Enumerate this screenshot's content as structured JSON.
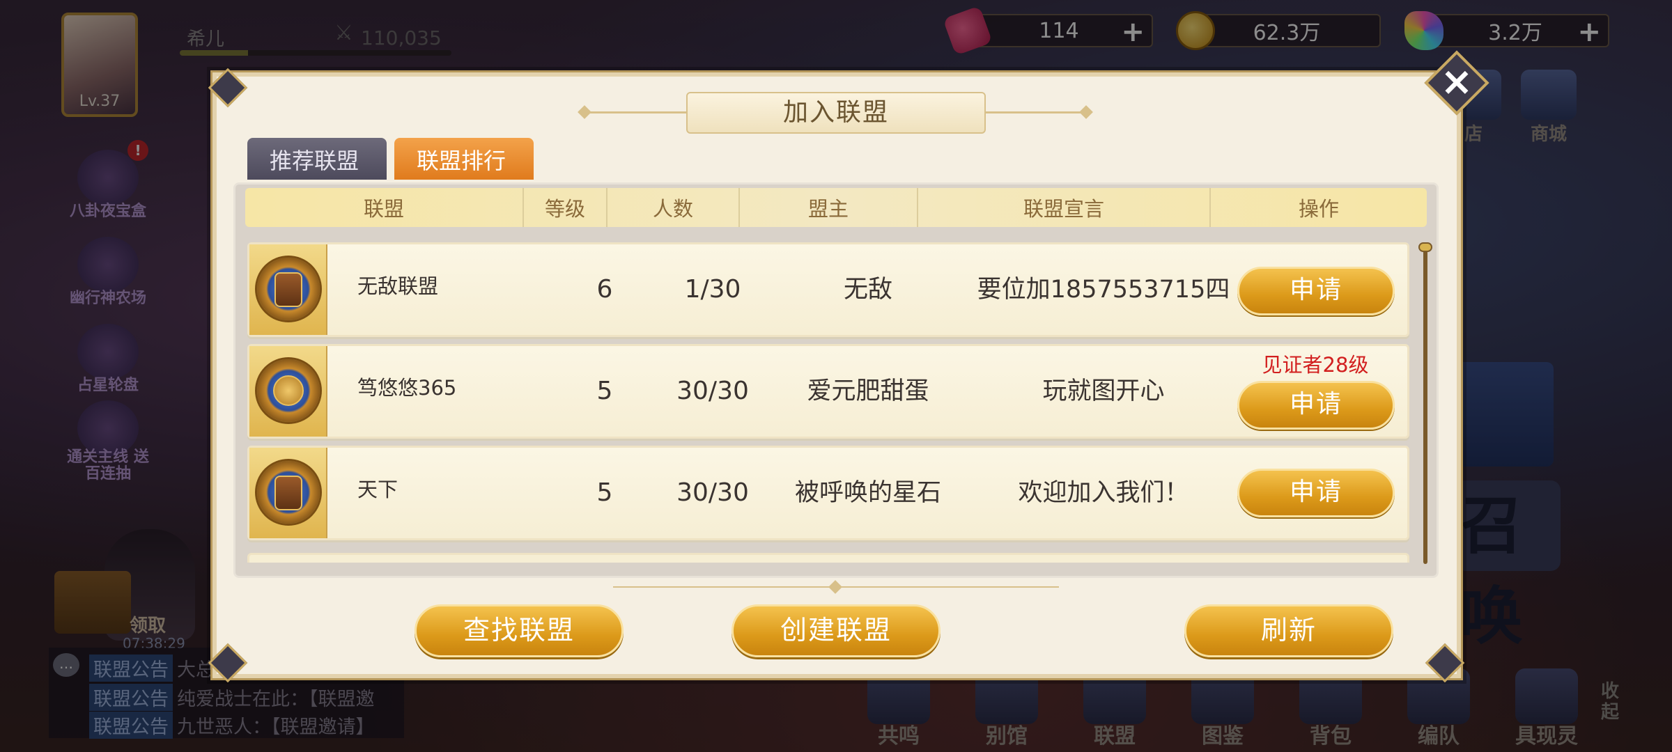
{
  "hud": {
    "player_name": "希儿",
    "level": "Lv.37",
    "power": "110,035",
    "exp_fraction": 0.25,
    "resources": [
      {
        "icon": "energy-can-icon",
        "value": "114",
        "has_plus": true
      },
      {
        "icon": "gold-coin-icon",
        "value": "62.3万",
        "has_plus": false
      },
      {
        "icon": "rainbow-gem-icon",
        "value": "3.2万",
        "has_plus": true
      }
    ]
  },
  "left_menu": [
    {
      "label": "八卦夜宝盒",
      "badge": "!"
    },
    {
      "label": "幽行神农场"
    },
    {
      "label": "占星轮盘"
    },
    {
      "label": "通关主线 送百连抽"
    }
  ],
  "left_reward": {
    "label": "领取",
    "time": "07:38:29"
  },
  "chat": [
    {
      "tag": "联盟公告",
      "text": "大总"
    },
    {
      "tag": "联盟公告",
      "text": "纯爱战士在此：【联盟邀"
    },
    {
      "tag": "联盟公告",
      "text": "九世恶人：【联盟邀请】"
    }
  ],
  "bottom_nav": [
    "共鸣",
    "别馆",
    "联盟",
    "图鉴",
    "背包",
    "编队",
    "具现灵"
  ],
  "collapse_label": "收起",
  "right_top": [
    "店",
    "商城"
  ],
  "right_panel_text": "召唤",
  "dialog": {
    "title": "加入联盟",
    "close_icon": "close-icon",
    "tabs": [
      {
        "label": "推荐联盟",
        "active": false
      },
      {
        "label": "联盟排行",
        "active": true
      }
    ],
    "columns": [
      "联盟",
      "等级",
      "人数",
      "盟主",
      "联盟宣言",
      "操作"
    ],
    "rows": [
      {
        "emblem": "clock-emblem-icon",
        "name": "无敌联盟",
        "level": "6",
        "members": "1/30",
        "leader": "无敌",
        "manifesto": "要位加1857553715四",
        "requirement": "",
        "action": "申请"
      },
      {
        "emblem": "globe-emblem-icon",
        "name": "笃悠悠365",
        "level": "5",
        "members": "30/30",
        "leader": "爱元肥甜蛋",
        "manifesto": "玩就图开心",
        "requirement": "见证者28级",
        "action": "申请"
      },
      {
        "emblem": "clock-emblem-icon",
        "name": "天下",
        "level": "5",
        "members": "30/30",
        "leader": "被呼唤的星石",
        "manifesto": "欢迎加入我们！",
        "requirement": "",
        "action": "申请"
      }
    ],
    "buttons": {
      "find": "查找联盟",
      "create": "创建联盟",
      "refresh": "刷新"
    }
  }
}
